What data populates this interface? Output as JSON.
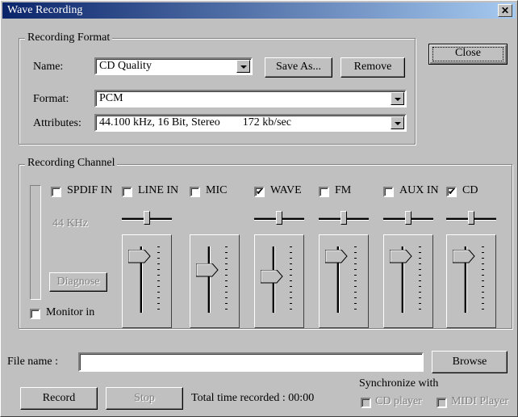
{
  "window": {
    "title": "Wave Recording",
    "close_glyph": "✕"
  },
  "recording_format": {
    "legend": "Recording Format",
    "name_label": "Name:",
    "name_value": "CD Quality",
    "save_as": "Save As...",
    "remove": "Remove",
    "format_label": "Format:",
    "format_value": "PCM",
    "attributes_label": "Attributes:",
    "attributes_value": "44.100 kHz, 16 Bit, Stereo        172 kb/sec"
  },
  "close_button": "Close",
  "recording_channel": {
    "legend": "Recording Channel",
    "sample_rate": "44 KHz",
    "diagnose": "Diagnose",
    "monitor_in": {
      "label": "Monitor in",
      "checked": false
    },
    "channels": [
      {
        "label": "SPDIF IN",
        "checked": false,
        "balance": null,
        "volume": null
      },
      {
        "label": "LINE IN",
        "checked": false,
        "balance": 0.5,
        "volume": 0.85
      },
      {
        "label": "MIC",
        "checked": false,
        "balance": null,
        "volume": 0.65
      },
      {
        "label": "WAVE",
        "checked": true,
        "balance": 0.5,
        "volume": 0.55
      },
      {
        "label": "FM",
        "checked": false,
        "balance": 0.5,
        "volume": 0.85
      },
      {
        "label": "AUX IN",
        "checked": false,
        "balance": 0.5,
        "volume": 0.85
      },
      {
        "label": "CD",
        "checked": true,
        "balance": 0.5,
        "volume": 0.85
      }
    ]
  },
  "file": {
    "label": "File name :",
    "value": "",
    "browse": "Browse"
  },
  "sync": {
    "label": "Synchronize with",
    "cd_player": "CD player",
    "midi_player": "MIDI Player"
  },
  "controls": {
    "record": "Record",
    "stop": "Stop",
    "total_label": "Total time recorded : 00:00"
  },
  "icons": {
    "checkbox_mark": "✔"
  }
}
